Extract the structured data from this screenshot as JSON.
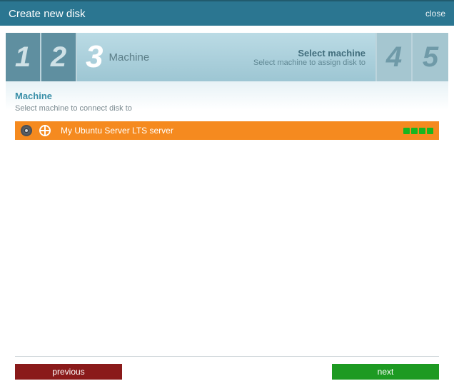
{
  "window": {
    "title": "Create new disk",
    "close_label": "close"
  },
  "steps": {
    "done": [
      "1",
      "2"
    ],
    "current": {
      "number": "3",
      "label": "Machine",
      "heading": "Select machine",
      "sub": "Select machine to assign disk to"
    },
    "future": [
      "4",
      "5"
    ]
  },
  "section": {
    "title": "Machine",
    "sub": "Select machine to connect disk to"
  },
  "machines": [
    {
      "disk_icon": "disk-icon",
      "os_icon": "ubuntu-icon",
      "name": "My Ubuntu Server LTS server",
      "signal_bars": 4,
      "selected": true
    }
  ],
  "footer": {
    "previous": "previous",
    "next": "next"
  }
}
